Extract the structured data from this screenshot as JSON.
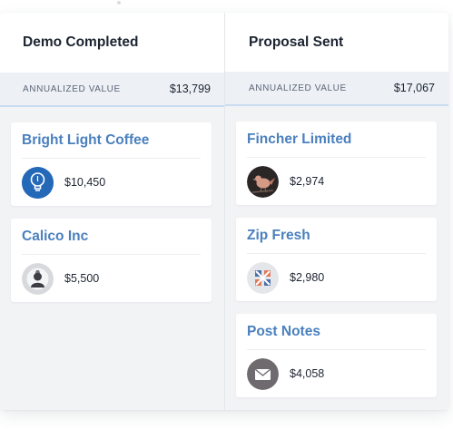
{
  "columns": [
    {
      "title": "Demo Completed",
      "summary_label": "ANNUALIZED VALUE",
      "summary_value": "$13,799",
      "cards": [
        {
          "name": "Bright Light Coffee",
          "value": "$10,450",
          "icon": "lightbulb-icon"
        },
        {
          "name": "Calico Inc",
          "value": "$5,500",
          "icon": "person-avatar-icon"
        }
      ]
    },
    {
      "title": "Proposal Sent",
      "summary_label": "ANNUALIZED VALUE",
      "summary_value": "$17,067",
      "cards": [
        {
          "name": "Fincher Limited",
          "value": "$2,974",
          "icon": "bird-icon"
        },
        {
          "name": "Zip Fresh",
          "value": "$2,980",
          "icon": "cross-logo-icon"
        },
        {
          "name": "Post Notes",
          "value": "$4,058",
          "icon": "envelope-icon"
        }
      ]
    }
  ],
  "colors": {
    "accent": "#4a80be",
    "summary_border": "#c9dcf1",
    "column_bg": "#f2f3f5"
  }
}
